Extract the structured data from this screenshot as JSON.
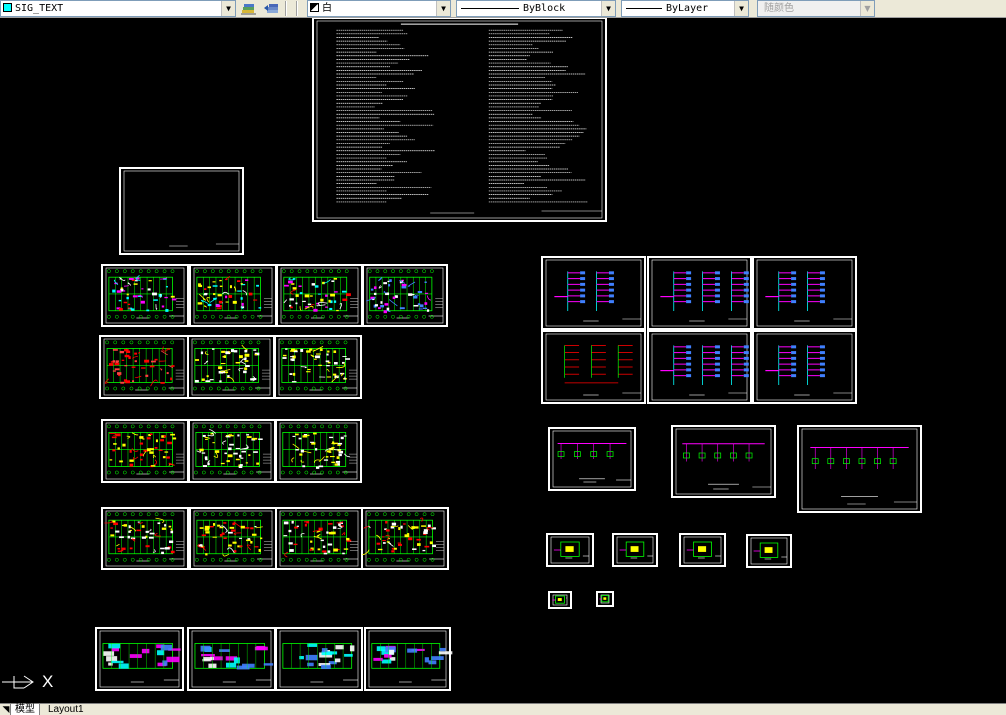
{
  "toolbar": {
    "layer_name": "SIG_TEXT",
    "layer_color": "#00ffff",
    "color_value": "白",
    "linetype_value": "ByBlock",
    "lineweight_value": "ByLayer",
    "plotstyle_value": "随颜色",
    "layer_icon": "layer-properties-icon",
    "layer_prev_icon": "layer-previous-icon"
  },
  "tabs": {
    "model": "模型",
    "layout1": "Layout1"
  },
  "ucs": {
    "x_label": "X",
    "icon": "ucs-icon"
  },
  "drawing": {
    "background": "#000000",
    "sheet_frame_color": "#ffffff",
    "line_colors": [
      "#00ff00",
      "#ffff00",
      "#ff0000",
      "#ff00ff",
      "#00ffff",
      "#4080ff",
      "#ffffff"
    ]
  }
}
